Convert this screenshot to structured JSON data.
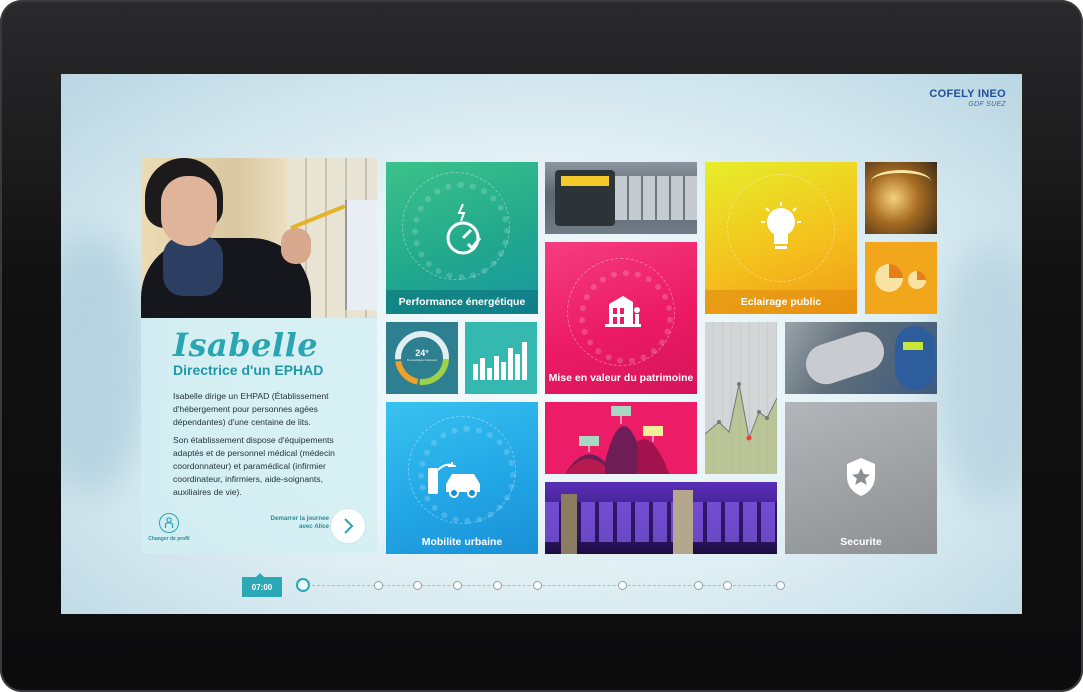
{
  "brand": {
    "logo_main": "COFELY INEO",
    "logo_sub": "GDF SUEZ"
  },
  "profile": {
    "name": "Isabelle",
    "role": "Directrice d'un EPHAD",
    "description_1": "Isabelle dirige un EHPAD (Établissement d'hébergement pour personnes agées dépendantes) d'une centaine de lits.",
    "description_2": "Son établissement dispose d'équipements adaptés et de personnel médical (médecin coordonnateur) et paramédical (infirmier coordinateur, infirmiers, aide-soignants, auxiliaires de vie).",
    "change_profile_label": "Changer de profil",
    "start_day_label": "Demarrer la journee avec Alice"
  },
  "tiles": {
    "performance": {
      "label": "Performance énergétique",
      "color": "#2fb37e"
    },
    "gauge": {
      "value": "24°",
      "sub": "Température intérieure"
    },
    "patrimoine": {
      "label": "Mise en valeur du patrimoine",
      "color": "#ef1f6f"
    },
    "mobilite": {
      "label": "Mobilite urbaine",
      "color": "#22a7e6"
    },
    "eclairage": {
      "label": "Eclairage public",
      "color": "#f2a81b"
    },
    "securite": {
      "label": "Securite",
      "color": "#9fa2a5"
    }
  },
  "timeline": {
    "time": "07:00"
  }
}
